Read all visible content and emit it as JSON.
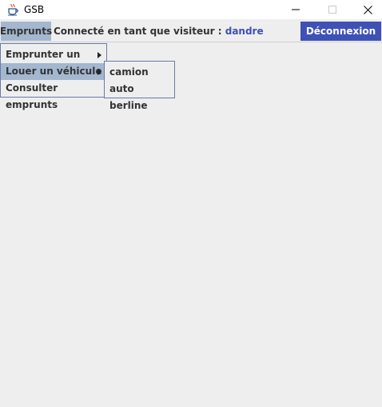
{
  "window": {
    "title": "GSB"
  },
  "menubar": {
    "menu_label": "Emprunts",
    "status_prefix": "Connecté en tant que visiteur :",
    "username": "dandre",
    "logout_label": "Déconnexion"
  },
  "menu": {
    "items": [
      {
        "label": "Emprunter un objet"
      },
      {
        "label": "Louer un véhicule"
      },
      {
        "label": "Consulter emprunts"
      }
    ]
  },
  "submenu": {
    "items": [
      {
        "label": "camion"
      },
      {
        "label": "auto berline"
      }
    ]
  },
  "colors": {
    "accent": "#3f51b5",
    "menu_selected": "#a3b7cf",
    "background": "#eeeeee"
  },
  "icons": {
    "app": "java-cup-icon",
    "minimize": "minimize-icon",
    "maximize": "maximize-icon",
    "close": "close-icon",
    "submenu": "chevron-right-icon"
  }
}
